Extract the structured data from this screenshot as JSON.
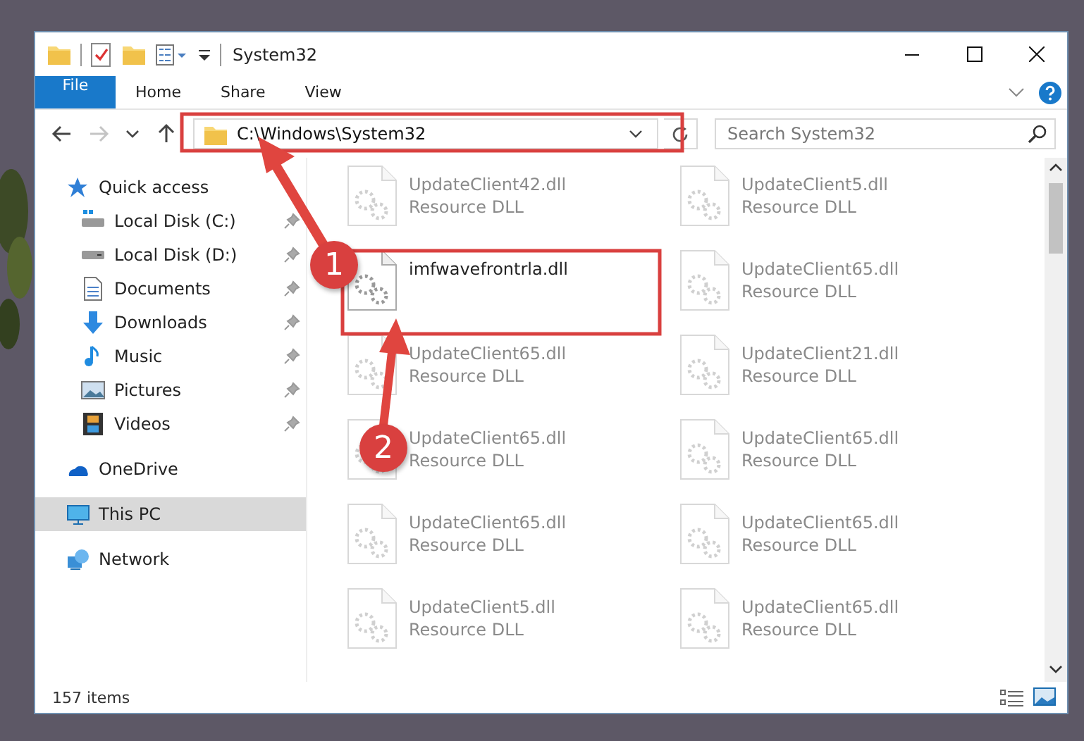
{
  "window": {
    "title": "System32"
  },
  "ribbon": {
    "tabs": [
      {
        "label": "File",
        "kind": "file"
      },
      {
        "label": "Home",
        "kind": "tab"
      },
      {
        "label": "Share",
        "kind": "tab"
      },
      {
        "label": "View",
        "kind": "tab"
      }
    ]
  },
  "navigation": [
    {
      "kind": "back",
      "disabled": false
    },
    {
      "kind": "forward",
      "disabled": true
    },
    {
      "kind": "recent",
      "disabled": false
    },
    {
      "kind": "up",
      "disabled": false
    }
  ],
  "address": {
    "path": "C:\\Windows\\System32"
  },
  "search": {
    "placeholder": "Search System32"
  },
  "nav": [
    {
      "label": "Quick access",
      "selected": false,
      "children": [
        {
          "label": "Local Disk (C:)",
          "pinned": true,
          "selected": false
        },
        {
          "label": "Local Disk (D:)",
          "pinned": true,
          "selected": false
        },
        {
          "label": "Documents",
          "pinned": true,
          "selected": false
        },
        {
          "label": "Downloads",
          "pinned": true,
          "selected": false
        },
        {
          "label": "Music",
          "pinned": true,
          "selected": false
        },
        {
          "label": "Pictures",
          "pinned": true,
          "selected": false
        },
        {
          "label": "Videos",
          "pinned": true,
          "selected": false
        }
      ]
    },
    {
      "label": "OneDrive",
      "selected": false
    },
    {
      "label": "This PC",
      "selected": true
    },
    {
      "label": "Network",
      "selected": false
    }
  ],
  "files": [
    {
      "name": "UpdateClient42.dll",
      "type": "Resource DLL",
      "blurred": true
    },
    {
      "name": "UpdateClient5.dll",
      "type": "Resource DLL",
      "blurred": true
    },
    {
      "name": "imfwavefrontrla.dll",
      "blurred": false
    },
    {
      "name": "UpdateClient65.dll",
      "type": "Resource DLL",
      "blurred": true
    },
    {
      "name": "UpdateClient65.dll",
      "type": "Resource DLL",
      "blurred": true
    },
    {
      "name": "UpdateClient21.dll",
      "type": "Resource DLL",
      "blurred": true
    },
    {
      "name": "UpdateClient65.dll",
      "type": "Resource DLL",
      "blurred": true
    },
    {
      "name": "UpdateClient65.dll",
      "type": "Resource DLL",
      "blurred": true
    },
    {
      "name": "UpdateClient65.dll",
      "type": "Resource DLL",
      "blurred": true
    },
    {
      "name": "UpdateClient65.dll",
      "type": "Resource DLL",
      "blurred": true
    },
    {
      "name": "UpdateClient5.dll",
      "type": "Resource DLL",
      "blurred": true
    },
    {
      "name": "UpdateClient65.dll",
      "type": "Resource DLL",
      "blurred": true
    }
  ],
  "status_bar": {
    "count": "157 items"
  },
  "callouts": [
    {
      "number": "1"
    },
    {
      "number": "2"
    }
  ]
}
